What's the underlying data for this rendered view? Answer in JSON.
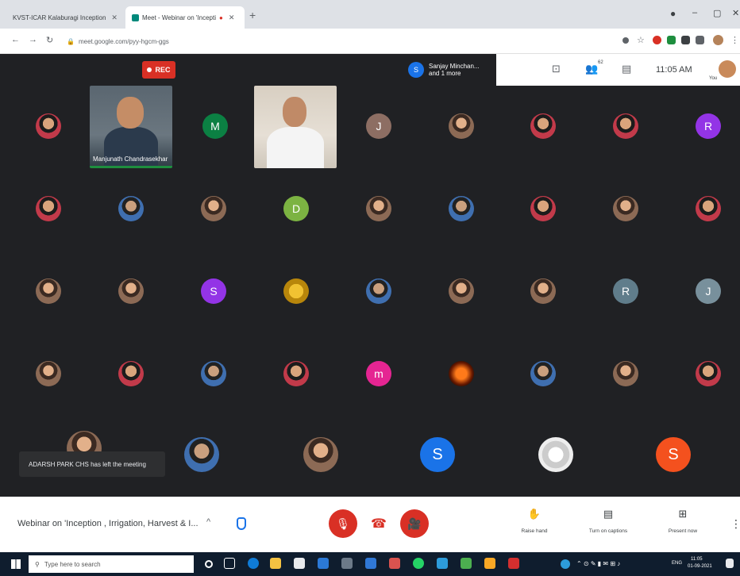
{
  "browser": {
    "tabs": [
      {
        "label": "KVST-ICAR Kalaburagi Inception",
        "active": false
      },
      {
        "label": "Meet - Webinar on 'Incepti",
        "active": true
      }
    ],
    "new_tab": "+",
    "window_controls": [
      "–",
      "▢",
      "✕"
    ],
    "url": "meet.google.com/pyy-hgcm-ggs"
  },
  "meet": {
    "rec_label": "REC",
    "presenting": {
      "avatar_letter": "S",
      "text": "Sanjay Minchan... and 1 more"
    },
    "clock": "11:05 AM",
    "you_label": "You",
    "participant_count": "62",
    "camera_tiles": [
      {
        "name": "Manjunath Chandrasekhar"
      },
      {
        "name": ""
      }
    ],
    "letter_tiles": [
      {
        "letter": "M",
        "color": "#0b8043"
      },
      {
        "letter": "J",
        "color": "#8d6e63"
      },
      {
        "letter": "R",
        "color": "#9334e6"
      },
      {
        "letter": "D",
        "color": "#7cb342"
      },
      {
        "letter": "S",
        "color": "#9334e6"
      },
      {
        "letter": "R",
        "color": "#607d8b"
      },
      {
        "letter": "J",
        "color": "#78909c"
      },
      {
        "letter": "m",
        "color": "#e52592"
      },
      {
        "letter": "S",
        "color": "#1a73e8"
      },
      {
        "letter": "S",
        "color": "#f4511e"
      }
    ],
    "toast": "ADARSH PARK CHS has left the meeting"
  },
  "controls": {
    "meeting_title": "Webinar on 'Inception , Irrigation, Harvest & I...",
    "title_chevron": "^",
    "mic_icon": "mic-off-icon",
    "end_icon": "call-end-icon",
    "cam_icon": "videocam-off-icon",
    "actions": [
      {
        "label": "Raise hand",
        "icon": "✋"
      },
      {
        "label": "Turn on captions",
        "icon": "▤"
      },
      {
        "label": "Present now",
        "icon": "⊞"
      }
    ],
    "more": "⋮"
  },
  "taskbar": {
    "search_placeholder": "Type here to search",
    "language": "ENG",
    "time": "11:05",
    "date": "01-09-2021"
  }
}
